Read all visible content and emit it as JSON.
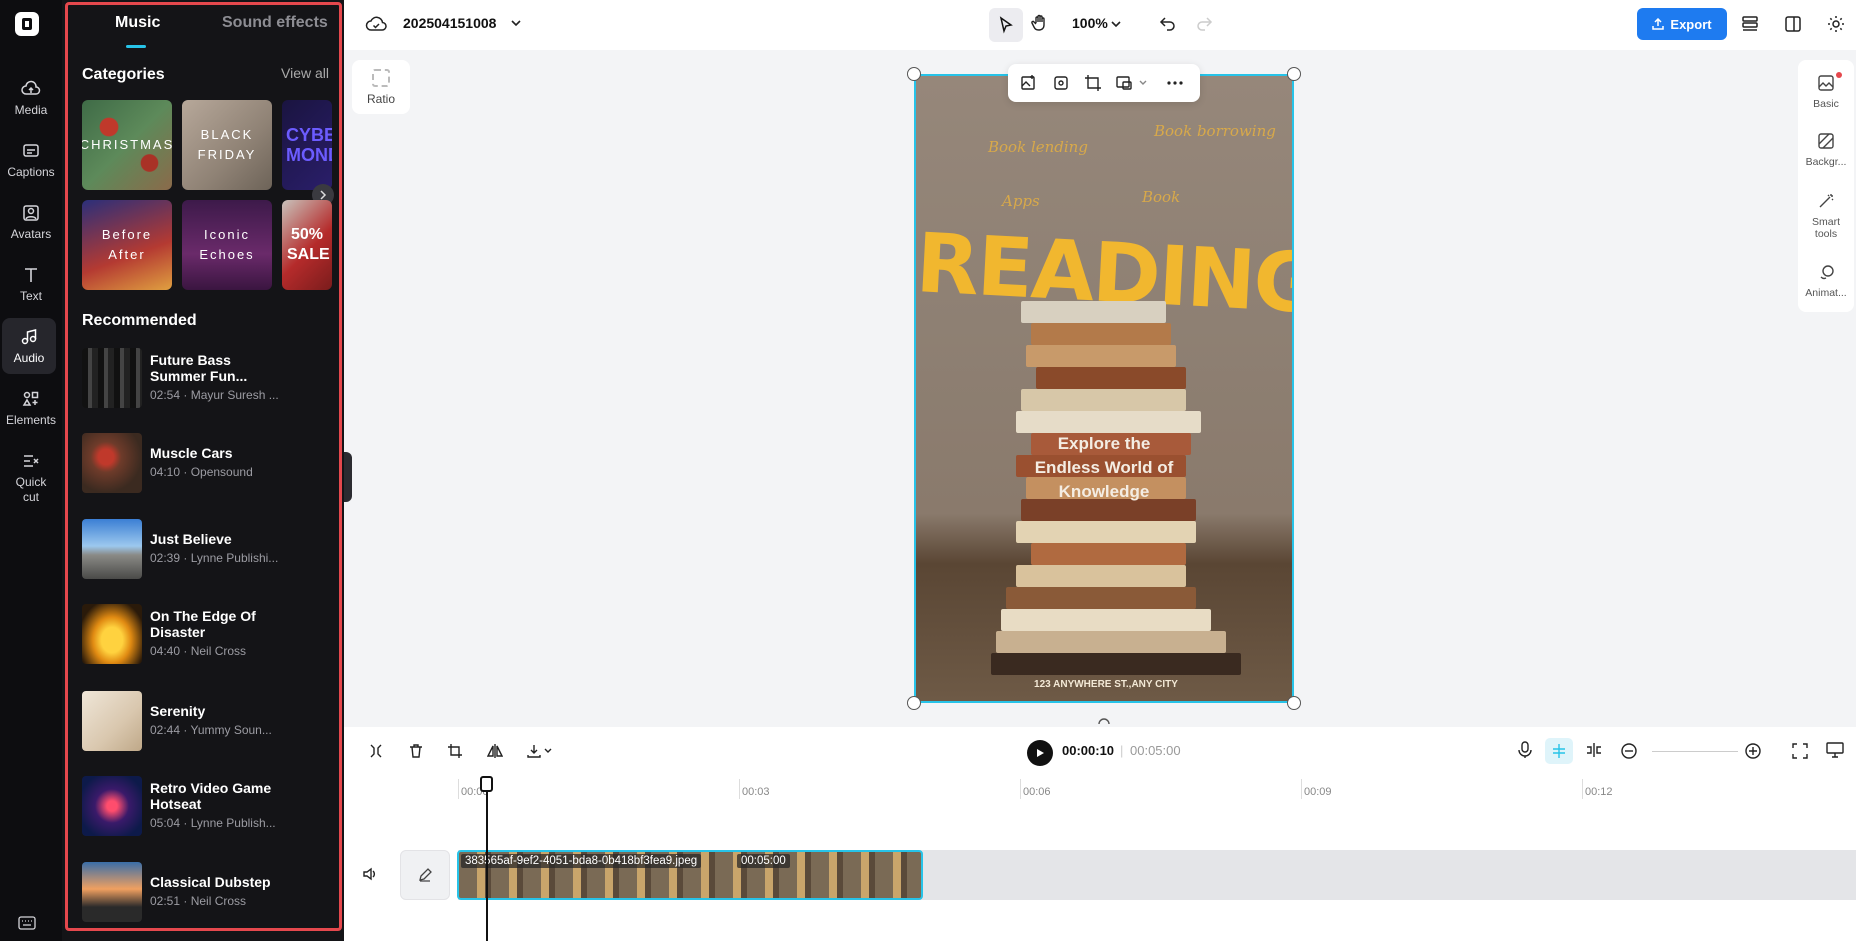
{
  "app": {
    "project_name": "202504151008",
    "zoom": "100%",
    "export_label": "Export"
  },
  "leftnav": {
    "items": [
      {
        "label": "Media"
      },
      {
        "label": "Captions"
      },
      {
        "label": "Avatars"
      },
      {
        "label": "Text"
      },
      {
        "label": "Audio"
      },
      {
        "label": "Elements"
      },
      {
        "label": "Quick cut"
      }
    ]
  },
  "panel": {
    "tabs": {
      "music": "Music",
      "sound_effects": "Sound effects"
    },
    "categories_title": "Categories",
    "view_all": "View all",
    "categories": [
      {
        "label": "CHRISTMAS"
      },
      {
        "label": "BLACK FRIDAY"
      },
      {
        "label": "CYBER MONDAY"
      },
      {
        "label": "Before After"
      },
      {
        "label": "Iconic Echoes"
      },
      {
        "label": "50% SALE"
      }
    ],
    "recommended_title": "Recommended",
    "tracks": [
      {
        "title": "Future Bass Summer Fun...",
        "meta": "02:54 · Mayur Suresh ..."
      },
      {
        "title": "Muscle Cars",
        "meta": "04:10 · Opensound"
      },
      {
        "title": "Just Believe",
        "meta": "02:39 · Lynne Publishi..."
      },
      {
        "title": "On The Edge Of Disaster",
        "meta": "04:40 · Neil Cross"
      },
      {
        "title": "Serenity",
        "meta": "02:44 · Yummy Soun..."
      },
      {
        "title": "Retro Video Game Hotseat",
        "meta": "05:04 · Lynne Publish..."
      },
      {
        "title": "Classical Dubstep",
        "meta": "02:51 · Neil Cross"
      }
    ]
  },
  "canvas": {
    "ratio_label": "Ratio",
    "headline": "READING",
    "cursive": [
      "Book lending",
      "Book borrowing",
      "Apps",
      "Book"
    ],
    "body": "Explore the Endless World of Knowledge",
    "address": "123 ANYWHERE ST.,ANY CITY"
  },
  "right_panel": {
    "items": [
      {
        "label": "Basic"
      },
      {
        "label": "Backgr..."
      },
      {
        "label": "Smart tools"
      },
      {
        "label": "Animat..."
      }
    ]
  },
  "timeline": {
    "current_time": "00:00:10",
    "total_time": "00:05:00",
    "ticks": [
      "00:00",
      "00:03",
      "00:06",
      "00:09",
      "00:12"
    ],
    "clip_name": "383565af-9ef2-4051-bda8-0b418bf3fea9.jpeg",
    "clip_duration": "00:05:00"
  },
  "colors": {
    "accent": "#27c3e8",
    "export": "#1e7bf0",
    "highlight": "#e5484d",
    "headline": "#f1b72f"
  }
}
